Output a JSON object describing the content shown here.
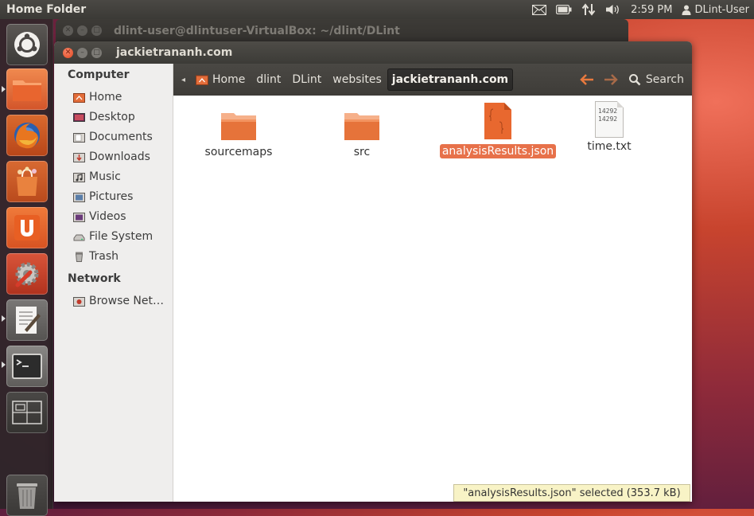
{
  "panel": {
    "title": "Home Folder",
    "time": "2:59 PM",
    "user": "DLint-User"
  },
  "launcher": {
    "items": [
      {
        "name": "dash-home"
      },
      {
        "name": "files"
      },
      {
        "name": "firefox"
      },
      {
        "name": "software-center"
      },
      {
        "name": "ubuntu-one"
      },
      {
        "name": "system-settings"
      },
      {
        "name": "text-editor"
      },
      {
        "name": "terminal"
      },
      {
        "name": "workspace-switcher"
      },
      {
        "name": "trash"
      }
    ]
  },
  "terminal_window": {
    "title": "dlint-user@dlintuser-VirtualBox: ~/dlint/DLint"
  },
  "window": {
    "title": "jackietrananh.com"
  },
  "sidebar": {
    "computer_heading": "Computer",
    "places": [
      {
        "label": "Home",
        "icon": "home-folder-icon"
      },
      {
        "label": "Desktop",
        "icon": "desktop-icon"
      },
      {
        "label": "Documents",
        "icon": "documents-icon"
      },
      {
        "label": "Downloads",
        "icon": "downloads-icon"
      },
      {
        "label": "Music",
        "icon": "music-icon"
      },
      {
        "label": "Pictures",
        "icon": "pictures-icon"
      },
      {
        "label": "Videos",
        "icon": "videos-icon"
      },
      {
        "label": "File System",
        "icon": "drive-icon"
      },
      {
        "label": "Trash",
        "icon": "trash-icon"
      }
    ],
    "network_heading": "Network",
    "network": [
      {
        "label": "Browse Net…",
        "icon": "network-icon"
      }
    ]
  },
  "toolbar": {
    "breadcrumbs": [
      "Home",
      "dlint",
      "DLint",
      "websites",
      "jackietrananh.com"
    ],
    "search_label": "Search"
  },
  "files": [
    {
      "name": "sourcemaps",
      "type": "folder",
      "selected": false
    },
    {
      "name": "src",
      "type": "folder",
      "selected": false
    },
    {
      "name": "analysisResults.json",
      "type": "json",
      "selected": true
    },
    {
      "name": "time.txt",
      "type": "text",
      "selected": false,
      "preview": [
        "14292",
        "14292"
      ]
    }
  ],
  "status": {
    "text": "\"analysisResults.json\" selected (353.7 kB)"
  },
  "colors": {
    "accent": "#e7714a",
    "panel": "#3c3b37",
    "folder": "#e6733a"
  }
}
